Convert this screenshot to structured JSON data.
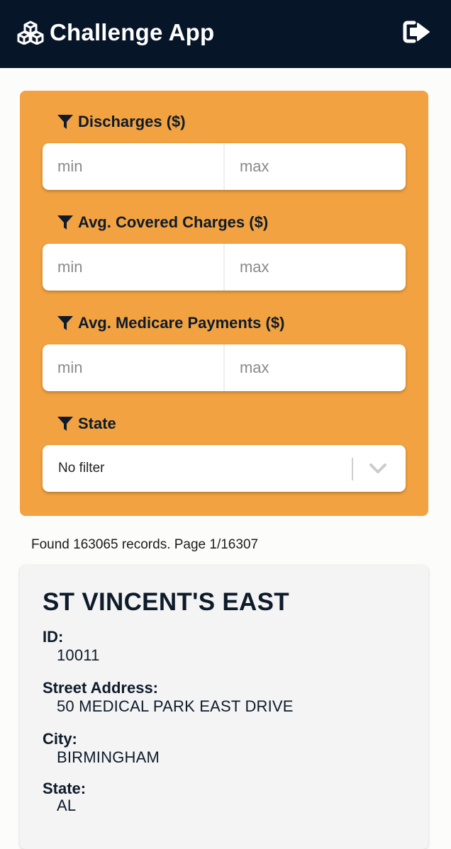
{
  "header": {
    "title": "Challenge App",
    "brand_icon": "cubes-icon",
    "logout_icon": "sign-out-icon",
    "background": "#061628"
  },
  "filters": {
    "accent": "#f2a241",
    "discharges": {
      "label": "Discharges ($)",
      "min_placeholder": "min",
      "max_placeholder": "max",
      "min_value": "",
      "max_value": ""
    },
    "avg_covered_charges": {
      "label": "Avg. Covered Charges ($)",
      "min_placeholder": "min",
      "max_placeholder": "max",
      "min_value": "",
      "max_value": ""
    },
    "avg_medicare_payments": {
      "label": "Avg. Medicare Payments ($)",
      "min_placeholder": "min",
      "max_placeholder": "max",
      "min_value": "",
      "max_value": ""
    },
    "state": {
      "label": "State",
      "selected": "No filter"
    }
  },
  "results": {
    "summary": "Found 163065 records. Page 1/16307"
  },
  "record": {
    "title": "ST VINCENT'S EAST",
    "fields": [
      {
        "label": "ID:",
        "value": "10011"
      },
      {
        "label": "Street Address:",
        "value": "50 MEDICAL PARK EAST DRIVE"
      },
      {
        "label": "City:",
        "value": "BIRMINGHAM"
      },
      {
        "label": "State:",
        "value": "AL"
      }
    ]
  }
}
